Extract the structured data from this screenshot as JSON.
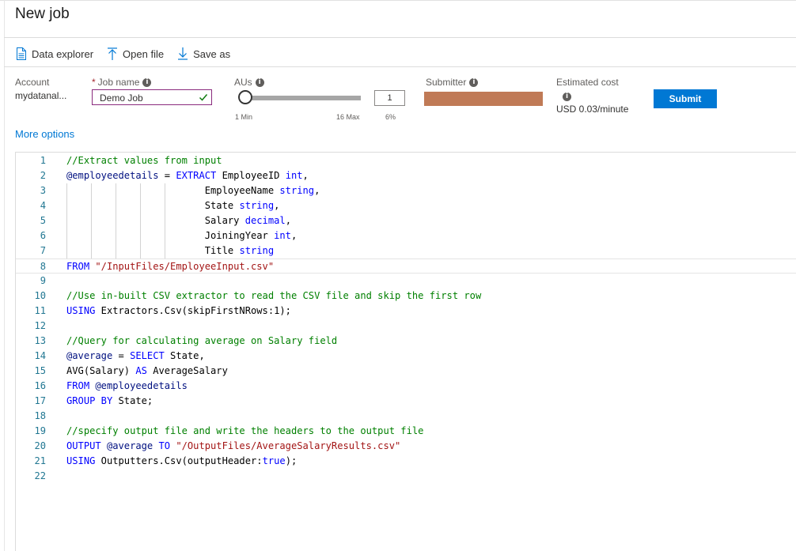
{
  "header": {
    "title": "New job"
  },
  "toolbar": {
    "items": [
      {
        "label": "Data explorer",
        "icon": "document-icon"
      },
      {
        "label": "Open file",
        "icon": "upload-arrow-icon"
      },
      {
        "label": "Save as",
        "icon": "download-arrow-icon"
      }
    ]
  },
  "form": {
    "account_label": "Account",
    "account_value": "mydatanal...",
    "jobname_label": "Job name",
    "jobname_required": "*",
    "jobname_value": "Demo Job",
    "aus_label": "AUs",
    "aus_value": "1",
    "aus_slider_fraction": 0.0,
    "aus_min_label": "1 Min",
    "aus_max_label": "16 Max",
    "aus_percent": "6%",
    "submitter_label": "Submitter",
    "submitter_color": "#c07a56",
    "cost_label": "Estimated cost",
    "cost_value": "USD 0.03/minute",
    "info_glyph": "i",
    "submit_label": "Submit",
    "more_options": "More options"
  },
  "colors": {
    "accent": "#0078d4",
    "jobname_border": "#8a2b7d",
    "valid_check": "#107c10"
  },
  "editor": {
    "current_line": 8,
    "lines": [
      {
        "n": "1",
        "tokens": [
          {
            "t": "//Extract values from input",
            "c": "comment"
          }
        ]
      },
      {
        "n": "2",
        "tokens": [
          {
            "t": "@employeedetails",
            "c": "var"
          },
          {
            "t": " = ",
            "c": "plain"
          },
          {
            "t": "EXTRACT",
            "c": "kw"
          },
          {
            "t": " EmployeeID ",
            "c": "plain"
          },
          {
            "t": "int",
            "c": "kw"
          },
          {
            "t": ",",
            "c": "plain"
          }
        ]
      },
      {
        "n": "3",
        "tokens": [
          {
            "t": "                        EmployeeName ",
            "c": "plain"
          },
          {
            "t": "string",
            "c": "kw"
          },
          {
            "t": ",",
            "c": "plain"
          }
        ]
      },
      {
        "n": "4",
        "tokens": [
          {
            "t": "                        State ",
            "c": "plain"
          },
          {
            "t": "string",
            "c": "kw"
          },
          {
            "t": ",",
            "c": "plain"
          }
        ]
      },
      {
        "n": "5",
        "tokens": [
          {
            "t": "                        Salary ",
            "c": "plain"
          },
          {
            "t": "decimal",
            "c": "kw"
          },
          {
            "t": ",",
            "c": "plain"
          }
        ]
      },
      {
        "n": "6",
        "tokens": [
          {
            "t": "                        JoiningYear ",
            "c": "plain"
          },
          {
            "t": "int",
            "c": "kw"
          },
          {
            "t": ",",
            "c": "plain"
          }
        ]
      },
      {
        "n": "7",
        "tokens": [
          {
            "t": "                        Title ",
            "c": "plain"
          },
          {
            "t": "string",
            "c": "kw"
          }
        ]
      },
      {
        "n": "8",
        "tokens": [
          {
            "t": "FROM",
            "c": "kw"
          },
          {
            "t": " ",
            "c": "plain"
          },
          {
            "t": "\"/InputFiles/EmployeeInput.csv\"",
            "c": "str"
          }
        ]
      },
      {
        "n": "9",
        "tokens": []
      },
      {
        "n": "10",
        "tokens": [
          {
            "t": "//Use in-built CSV extractor to read the CSV file and skip the first row",
            "c": "comment"
          }
        ]
      },
      {
        "n": "11",
        "tokens": [
          {
            "t": "USING",
            "c": "kw"
          },
          {
            "t": " Extractors.Csv(skipFirstNRows:1);",
            "c": "plain"
          }
        ]
      },
      {
        "n": "12",
        "tokens": []
      },
      {
        "n": "13",
        "tokens": [
          {
            "t": "//Query for calculating average on Salary field",
            "c": "comment"
          }
        ]
      },
      {
        "n": "14",
        "tokens": [
          {
            "t": "@average",
            "c": "var"
          },
          {
            "t": " = ",
            "c": "plain"
          },
          {
            "t": "SELECT",
            "c": "kw"
          },
          {
            "t": " State,",
            "c": "plain"
          }
        ]
      },
      {
        "n": "15",
        "tokens": [
          {
            "t": "AVG(Salary) ",
            "c": "plain"
          },
          {
            "t": "AS",
            "c": "kw"
          },
          {
            "t": " AverageSalary",
            "c": "plain"
          }
        ]
      },
      {
        "n": "16",
        "tokens": [
          {
            "t": "FROM",
            "c": "kw"
          },
          {
            "t": " ",
            "c": "plain"
          },
          {
            "t": "@employeedetails",
            "c": "var"
          }
        ]
      },
      {
        "n": "17",
        "tokens": [
          {
            "t": "GROUP BY",
            "c": "kw"
          },
          {
            "t": " State;",
            "c": "plain"
          }
        ]
      },
      {
        "n": "18",
        "tokens": []
      },
      {
        "n": "19",
        "tokens": [
          {
            "t": "//specify output file and write the headers to the output file",
            "c": "comment"
          }
        ]
      },
      {
        "n": "20",
        "tokens": [
          {
            "t": "OUTPUT",
            "c": "kw"
          },
          {
            "t": " ",
            "c": "plain"
          },
          {
            "t": "@average",
            "c": "var"
          },
          {
            "t": " ",
            "c": "plain"
          },
          {
            "t": "TO",
            "c": "kw"
          },
          {
            "t": " ",
            "c": "plain"
          },
          {
            "t": "\"/OutputFiles/AverageSalaryResults.csv\"",
            "c": "str"
          }
        ]
      },
      {
        "n": "21",
        "tokens": [
          {
            "t": "USING",
            "c": "kw"
          },
          {
            "t": " Outputters.Csv(outputHeader:",
            "c": "plain"
          },
          {
            "t": "true",
            "c": "kw"
          },
          {
            "t": ");",
            "c": "plain"
          }
        ]
      },
      {
        "n": "22",
        "tokens": []
      }
    ]
  }
}
